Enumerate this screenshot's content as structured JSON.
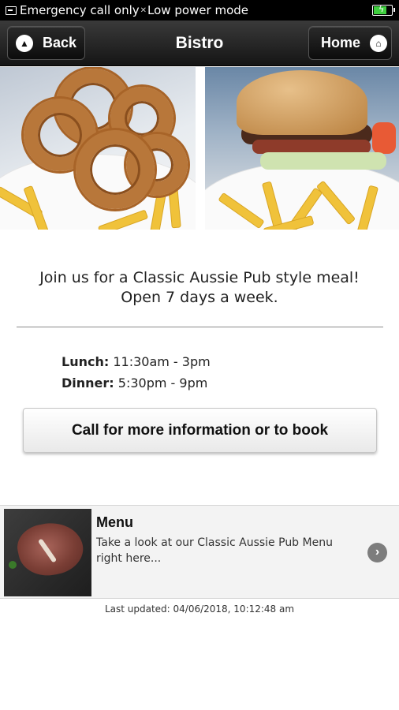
{
  "status_bar": {
    "text": "Emergency call only",
    "mode": "Low power mode",
    "battery_level": 0.75,
    "battery_color": "#3fcf3f"
  },
  "navbar": {
    "title": "Bistro",
    "back_label": "Back",
    "home_label": "Home",
    "back_icon": "chevron-up-circle-icon",
    "home_icon": "house-icon"
  },
  "intro": {
    "line1": "Join us for a Classic Aussie Pub style meal!",
    "line2": "Open 7 days a week."
  },
  "hours": {
    "lunch_label": "Lunch:",
    "lunch_value": "11:30am - 3pm",
    "dinner_label": "Dinner:",
    "dinner_value": "5:30pm - 9pm"
  },
  "call_button": "Call for more information or to book",
  "menu_card": {
    "title": "Menu",
    "description": "Take a look at our Classic Aussie Pub Menu right here...",
    "icon": "chevron-right-circle-icon"
  },
  "footer": {
    "last_updated": "Last updated: 04/06/2018, 10:12:48 am"
  },
  "colors": {
    "navbar": "#1f1f1f",
    "chevron": "#7d7d7d"
  }
}
